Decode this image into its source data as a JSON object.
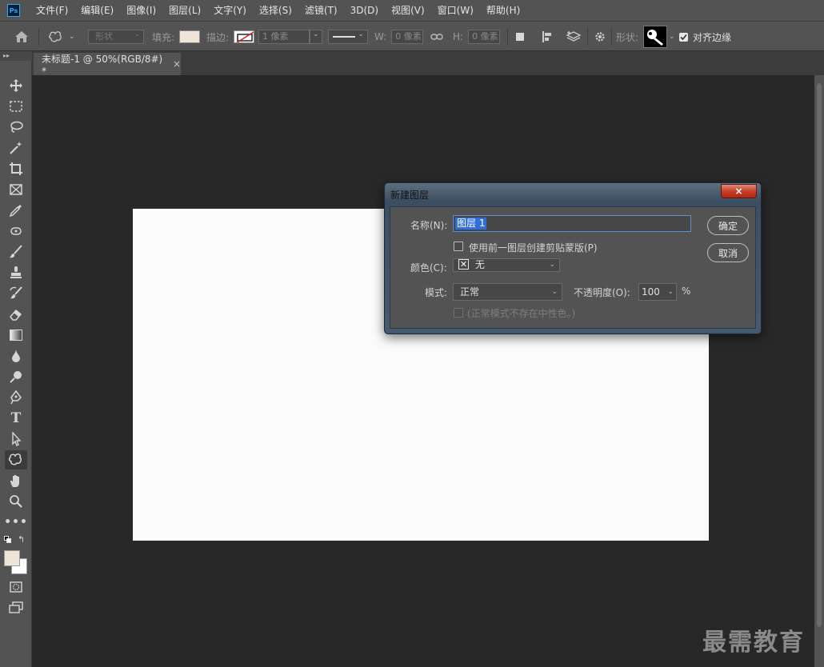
{
  "app": {
    "logo": "Ps",
    "menu": [
      "文件(F)",
      "编辑(E)",
      "图像(I)",
      "图层(L)",
      "文字(Y)",
      "选择(S)",
      "滤镜(T)",
      "3D(D)",
      "视图(V)",
      "窗口(W)",
      "帮助(H)"
    ]
  },
  "options": {
    "mode_value": "形状",
    "fill_label": "填充:",
    "fill_color": "#efe5d8",
    "stroke_label": "描边:",
    "stroke_size": "1 像素",
    "w_label": "W:",
    "w_value": "0 像素",
    "h_label": "H:",
    "h_value": "0 像素",
    "shape_label": "形状:",
    "align_edges_label": "对齐边缘"
  },
  "document": {
    "tab_title": "未标题-1 @ 50%(RGB/8#) *",
    "tab_close": "×"
  },
  "tools": [
    "move-icon",
    "marquee-icon",
    "lasso-icon",
    "magic-wand-icon",
    "crop-icon",
    "frame-icon",
    "eyedropper-icon",
    "healing-icon",
    "brush-icon",
    "stamp-icon",
    "history-brush-icon",
    "eraser-icon",
    "gradient-icon",
    "blur-icon",
    "dodge-icon",
    "pen-icon",
    "type-icon",
    "path-select-icon",
    "custom-shape-icon",
    "hand-icon",
    "zoom-icon",
    "more-icon"
  ],
  "colors": {
    "foreground": "#efe5d8",
    "background": "#ffffff"
  },
  "dialog": {
    "title": "新建图层",
    "close": "×",
    "name_label": "名称(N):",
    "name_value": "图层 1",
    "clip_label": "使用前一图层创建剪贴蒙版(P)",
    "color_label": "颜色(C):",
    "color_value": "无",
    "mode_label": "模式:",
    "mode_value": "正常",
    "opacity_label": "不透明度(O):",
    "opacity_value": "100",
    "opacity_unit": "%",
    "neutral_label": "(正常模式不存在中性色。)",
    "ok": "确定",
    "cancel": "取消"
  },
  "watermark": "最需教育"
}
